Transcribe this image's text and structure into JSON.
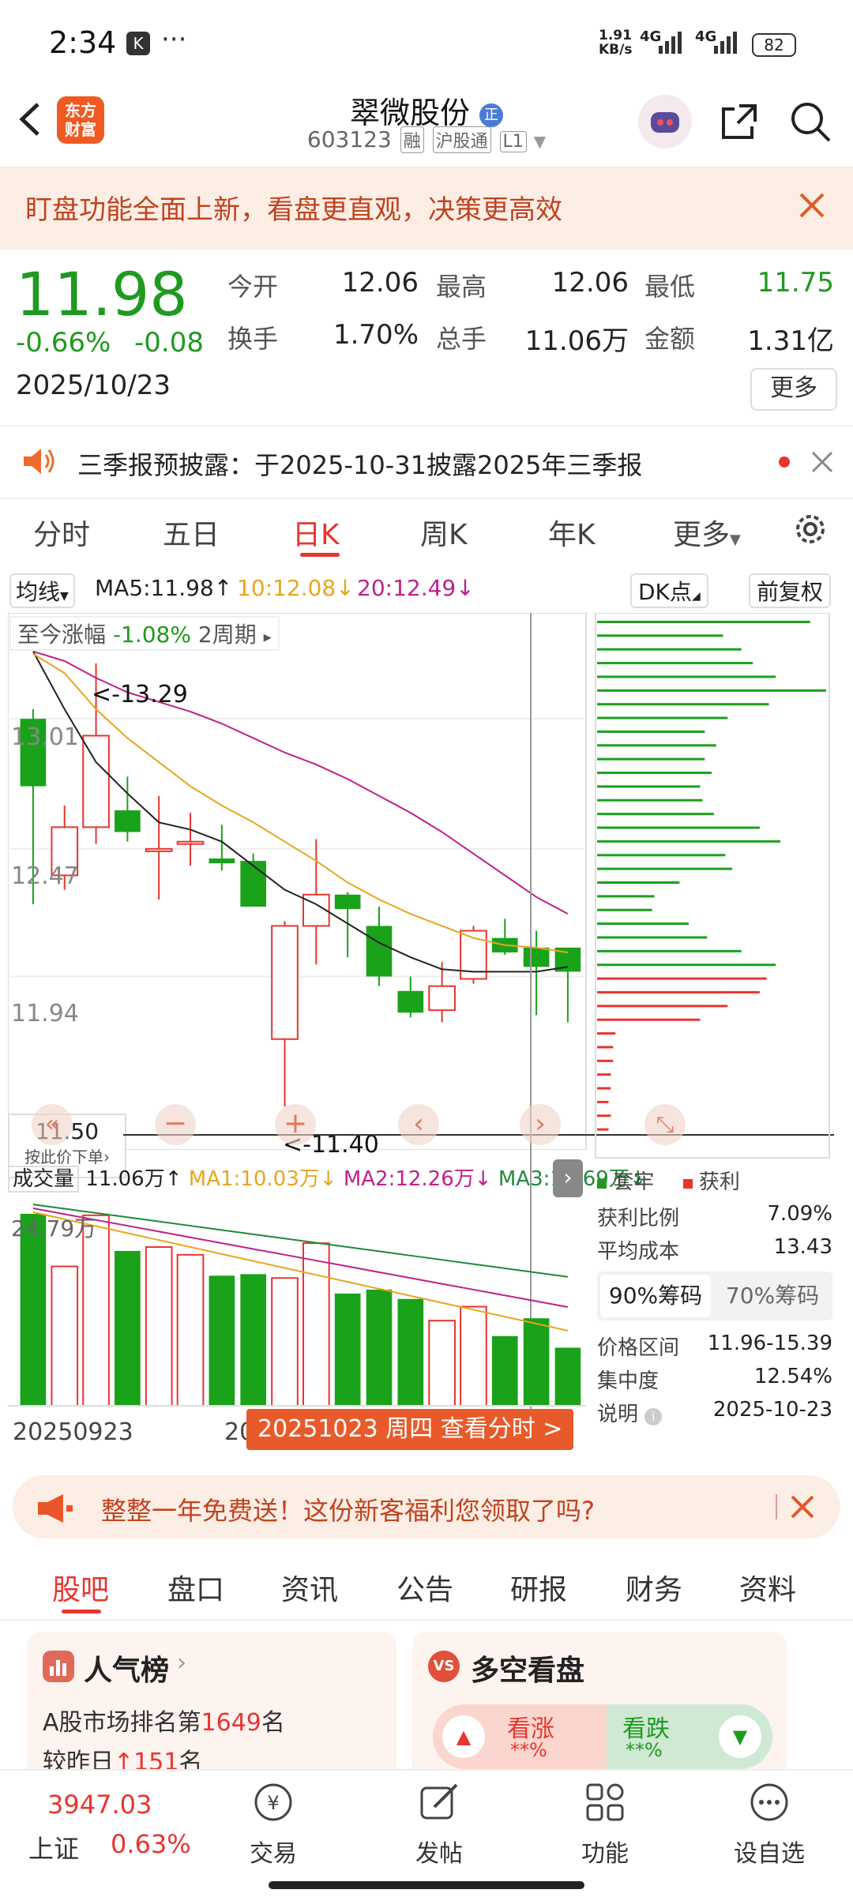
{
  "status_bar": {
    "time": "2:34",
    "net_speed": "1.91\nKB/s",
    "sig1": "4G",
    "sig2": "4G",
    "battery": "82"
  },
  "header": {
    "logo": "东方\n财富",
    "title": "翠微股份",
    "code": "603123",
    "tags": [
      "融",
      "沪股通",
      "L1"
    ]
  },
  "banner": {
    "text": "盯盘功能全面上新，看盘更直观，决策更高效"
  },
  "quote": {
    "price": "11.98",
    "change_pct": "-0.66%",
    "change": "-0.08",
    "date": "2025/10/23",
    "fields": [
      {
        "label": "今开",
        "value": "12.06"
      },
      {
        "label": "最高",
        "value": "12.06"
      },
      {
        "label": "最低",
        "value": "11.75"
      },
      {
        "label": "换手",
        "value": "1.70%"
      },
      {
        "label": "总手",
        "value": "11.06万"
      },
      {
        "label": "金额",
        "value": "1.31亿"
      }
    ],
    "more": "更多"
  },
  "notice": {
    "text": "三季报预披露：于2025-10-31披露2025年三季报"
  },
  "ktabs": [
    "分时",
    "五日",
    "日K",
    "周K",
    "年K",
    "更多"
  ],
  "chart_header": {
    "ma_select": "均线",
    "ma5": "MA5:11.98",
    "ma10": "10:12.08",
    "ma20": "20:12.49",
    "dk": "DK点",
    "adjust": "前复权"
  },
  "range_info": {
    "label": "至今涨幅",
    "value": "-1.08%",
    "period": "2周期"
  },
  "chart_data": {
    "type": "candlestick",
    "ylabels": [
      "13.01",
      "12.47",
      "11.94"
    ],
    "price_tip": "11.50",
    "price_tip_sub": "按此价下单",
    "high_annot": "<-13.29",
    "low_annot": "<-11.40",
    "candles": [
      {
        "o": 12.73,
        "c": 13.01,
        "h": 13.05,
        "l": 12.24,
        "up": false
      },
      {
        "o": 12.36,
        "c": 12.56,
        "h": 12.65,
        "l": 12.3,
        "up": true
      },
      {
        "o": 12.56,
        "c": 12.94,
        "h": 13.24,
        "l": 12.49,
        "up": true
      },
      {
        "o": 12.63,
        "c": 12.54,
        "h": 12.77,
        "l": 12.5,
        "up": false
      },
      {
        "o": 12.47,
        "c": 12.46,
        "h": 12.69,
        "l": 12.26,
        "up": true
      },
      {
        "o": 12.5,
        "c": 12.49,
        "h": 12.62,
        "l": 12.4,
        "up": true
      },
      {
        "o": 12.43,
        "c": 12.41,
        "h": 12.57,
        "l": 12.38,
        "up": false
      },
      {
        "o": 12.42,
        "c": 12.23,
        "h": 12.45,
        "l": 12.23,
        "up": false
      },
      {
        "o": 11.68,
        "c": 12.15,
        "h": 12.17,
        "l": 11.4,
        "up": true
      },
      {
        "o": 12.15,
        "c": 12.28,
        "h": 12.51,
        "l": 11.99,
        "up": true
      },
      {
        "o": 12.28,
        "c": 12.22,
        "h": 12.29,
        "l": 12.02,
        "up": false
      },
      {
        "o": 12.15,
        "c": 11.94,
        "h": 12.23,
        "l": 11.9,
        "up": false
      },
      {
        "o": 11.88,
        "c": 11.79,
        "h": 11.94,
        "l": 11.77,
        "up": false
      },
      {
        "o": 11.8,
        "c": 11.9,
        "h": 12.0,
        "l": 11.75,
        "up": true
      },
      {
        "o": 11.93,
        "c": 12.13,
        "h": 12.15,
        "l": 11.91,
        "up": true
      },
      {
        "o": 12.1,
        "c": 12.04,
        "h": 12.18,
        "l": 12.03,
        "up": false
      },
      {
        "o": 12.06,
        "c": 11.98,
        "h": 12.13,
        "l": 11.78,
        "up": false
      },
      {
        "o": 12.06,
        "c": 11.96,
        "h": 12.06,
        "l": 11.75,
        "up": false
      }
    ],
    "ma5": [
      13.29,
      13.05,
      12.83,
      12.7,
      12.58,
      12.55,
      12.5,
      12.4,
      12.3,
      12.24,
      12.16,
      12.08,
      12.02,
      11.97,
      11.96,
      11.96,
      11.96,
      11.98
    ],
    "ma10": [
      13.28,
      13.2,
      13.05,
      12.93,
      12.83,
      12.73,
      12.65,
      12.58,
      12.5,
      12.42,
      12.33,
      12.26,
      12.2,
      12.15,
      12.1,
      12.07,
      12.06,
      12.04
    ],
    "ma20": [
      13.29,
      13.25,
      13.18,
      13.12,
      13.08,
      13.04,
      12.99,
      12.93,
      12.87,
      12.82,
      12.76,
      12.69,
      12.62,
      12.54,
      12.45,
      12.36,
      12.27,
      12.2
    ],
    "volume_label": "成交量",
    "volume_vals": "11.06万",
    "vol_ma1": "MA1:10.03万",
    "vol_ma2": "MA2:12.26万",
    "vol_ma3": "MA3:16.69万",
    "vol_max_label": "24.79万",
    "volumes": [
      24.79,
      18.0,
      24.6,
      20.0,
      20.5,
      19.5,
      16.8,
      17.0,
      16.5,
      21.0,
      14.5,
      15.0,
      13.8,
      11.0,
      12.8,
      9.0,
      11.3,
      7.5
    ],
    "date_start": "20250923",
    "date_mid": "20",
    "date_tip": "20251023 周四 查看分时 >"
  },
  "chips": {
    "legend": [
      "套牢",
      "获利"
    ],
    "rows": [
      {
        "label": "获利比例",
        "value": "7.09%"
      },
      {
        "label": "平均成本",
        "value": "13.43"
      }
    ],
    "tabs": [
      "90%筹码",
      "70%筹码"
    ],
    "rows2": [
      {
        "label": "价格区间",
        "value": "11.96-15.39"
      },
      {
        "label": "集中度",
        "value": "12.54%"
      },
      {
        "label": "说明",
        "value": "2025-10-23"
      }
    ],
    "bars": [
      0.93,
      0.55,
      0.63,
      0.68,
      0.78,
      1.0,
      0.75,
      0.57,
      0.47,
      0.52,
      0.47,
      0.5,
      0.45,
      0.46,
      0.51,
      0.71,
      0.8,
      0.56,
      0.59,
      0.36,
      0.25,
      0.24,
      0.4,
      0.48,
      0.63,
      0.78,
      0.74,
      0.71,
      0.57,
      0.45,
      0.08,
      0.07,
      0.07,
      0.06,
      0.06,
      0.05,
      0.06,
      0.05
    ],
    "bar_colors": [
      "g",
      "g",
      "g",
      "g",
      "g",
      "g",
      "g",
      "g",
      "g",
      "g",
      "g",
      "g",
      "g",
      "g",
      "g",
      "g",
      "g",
      "g",
      "g",
      "g",
      "g",
      "g",
      "g",
      "g",
      "g",
      "g",
      "r",
      "r",
      "r",
      "r",
      "r",
      "r",
      "r",
      "r",
      "r",
      "r",
      "r",
      "r"
    ]
  },
  "ad": {
    "text": "整整一年免费送！这份新客福利您领取了吗?"
  },
  "bottom_tabs": [
    "股吧",
    "盘口",
    "资讯",
    "公告",
    "研报",
    "财务",
    "资料"
  ],
  "card_left": {
    "title": "人气榜",
    "line1_pre": "A股市场排名第",
    "line1_num": "1649",
    "line1_suf": "名",
    "line2_pre": "较昨日",
    "line2_num": "151",
    "line2_suf": "名"
  },
  "card_right": {
    "title": "多空看盘",
    "up": "看涨",
    "down": "看跌",
    "pct": "**%"
  },
  "nav": {
    "index_val": "3947.03",
    "index_name": "上证",
    "index_pct": "0.63%",
    "items": [
      "交易",
      "发帖",
      "功能",
      "设自选"
    ]
  }
}
